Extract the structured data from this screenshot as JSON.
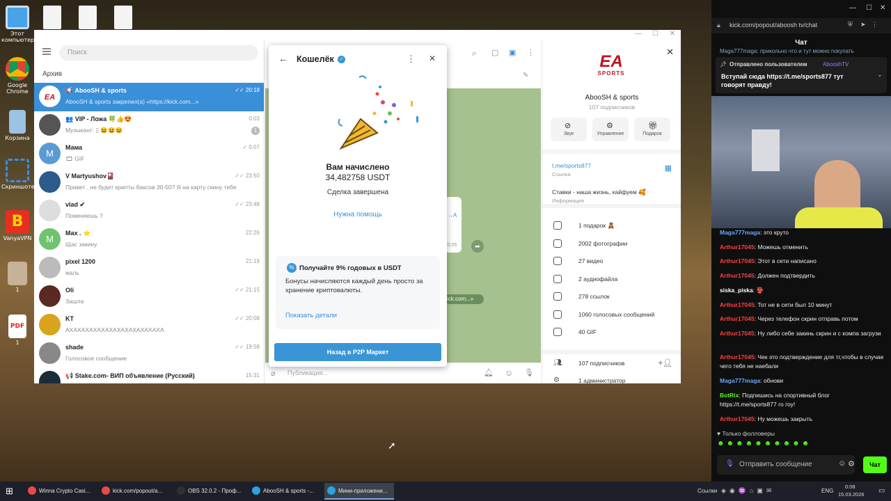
{
  "desktop": {
    "icons": [
      {
        "label": "Этот компьютер"
      },
      {
        "label": "Google Chrome"
      },
      {
        "label": "Корзина"
      },
      {
        "label": "Скриншотер"
      },
      {
        "label": "VanyaVPN"
      },
      {
        "label": "1"
      },
      {
        "label": "1"
      }
    ]
  },
  "telegram": {
    "search_placeholder": "Поиск",
    "archive_label": "Архив",
    "chats": [
      {
        "name": "📢 AbooSH & sports",
        "preview": "AbooSH & sports закрепил(а) «https://kick.com...»",
        "time": "✓✓ 20:18",
        "color": "#ffffff",
        "active": true
      },
      {
        "name": "👥 VIP - Ложа 🍀👍😍",
        "preview": "Музыкант: ▯ 😆😆😆",
        "time": "0:03",
        "badge": "1",
        "color": "#555555"
      },
      {
        "name": "Мама",
        "preview": "🎞 GIF",
        "time": "✓ 0:07",
        "color": "#5b9bd5",
        "initial": "M"
      },
      {
        "name": "V Martyushov🎴",
        "preview": "Привет , не будет крипты баксов 30-50? Я на карту скину тебе",
        "time": "✓✓ 23:50",
        "color": "#2e5a8c"
      },
      {
        "name": "vlad ✔",
        "preview": "Поменяешь ?",
        "time": "✓✓ 23:48",
        "color": "#dddddd"
      },
      {
        "name": "Max . ⭐",
        "preview": "Щас закину",
        "time": "22:26",
        "color": "#6fc36f",
        "initial": "M"
      },
      {
        "name": "pixel 1200",
        "preview": "жаль",
        "time": "21:19",
        "color": "#bbbbbb"
      },
      {
        "name": "Oli",
        "preview": "Зашла",
        "time": "✓✓ 21:15",
        "color": "#5a2a22"
      },
      {
        "name": "KT",
        "preview": "АХАХАХАХАХАХАХАХАХАХАХАХА",
        "time": "✓✓ 20:08",
        "color": "#d9a31c"
      },
      {
        "name": "shade",
        "preview": "Голосовое сообщение",
        "time": "✓✓ 19:58",
        "color": "#888888"
      },
      {
        "name": "📢 Stake.com- ВИП объявление (Русский)",
        "preview": "",
        "time": "15:31",
        "color": "#1a2c38"
      }
    ],
    "chat_input_placeholder": "Публикация...",
    "pinned_link": "ick.com...»",
    "msg_time": "20:05"
  },
  "wallet": {
    "title": "Кошелёк",
    "credited_label": "Вам начислено",
    "amount": "34,482758 USDT",
    "status": "Сделка завершена",
    "help_link": "Нужна помощь",
    "promo_title": "Получайте 9% годовых в USDT",
    "promo_text": "Бонусы начисляются каждый день просто за хранение криптовалюты.",
    "promo_link": "Показать детали",
    "back_button": "Назад в P2P Маркет"
  },
  "channel_info": {
    "name": "AbooSH & sports",
    "subscribers": "107 подписчиков",
    "actions": [
      "Звук",
      "Управление",
      "Подарок"
    ],
    "link": "t.me/sports877",
    "link_label": "Ссылка",
    "about": "Ставки - наша жизнь, кайфуем 🥰",
    "about_label": "Информация",
    "stats": [
      "1 подарок 🧸",
      "2002 фотографии",
      "27 видео",
      "2 аудиофайла",
      "278 ссылок",
      "1060 голосовых сообщений",
      "40 GIF"
    ],
    "members": "107 подписчиков",
    "admins": "1 администратор"
  },
  "kick": {
    "url": "kick.com/popout/aboosh tv/chat",
    "header": "Чат",
    "pinned_by": "Отправлено пользователем",
    "pinned_user": "AbooshTV",
    "pinned_text": "Вступай сюда https://t.me/sports877 тут говорят правду!",
    "top_line": "Maga777maga: прикольно что и тут можно покупать",
    "messages": [
      {
        "user": "Maga777maga",
        "text": "это круто",
        "color": "#6aa8ff"
      },
      {
        "user": "Arthur17045",
        "text": "Можешь отменить",
        "color": "#ff4040"
      },
      {
        "user": "Arthur17045",
        "text": "Этот в сети написано",
        "color": "#ff4040"
      },
      {
        "user": "Arthur17045",
        "text": "Должен подтвердить",
        "color": "#ff4040"
      },
      {
        "user": "siska_piska",
        "text": "👺",
        "color": "#ffffff"
      },
      {
        "user": "Arthur17045",
        "text": "Тот не в сети был 10 минут",
        "color": "#ff4040"
      },
      {
        "user": "Arthur17045",
        "text": "Через телефон скрин отправь потом",
        "color": "#ff4040"
      },
      {
        "user": "Arthur17045",
        "text": "Ну либо себе закинь скрин и с компа загрузи",
        "color": "#ff4040"
      },
      {
        "user": "Arthur17045",
        "text": "Чек это подтверждение для тг,чтобы в случае чего тебя не наебали",
        "color": "#ff4040"
      },
      {
        "user": "Maga777maga",
        "text": "обнови",
        "color": "#6aa8ff"
      },
      {
        "user": "BotRix",
        "text": "Подпишись на спортивный блог https://t.me/sports877 го гоу!",
        "color": "#53fc18"
      },
      {
        "user": "Arthur17045",
        "text": "Ну можешь закрыть",
        "color": "#ff4040"
      }
    ],
    "followers_only": "Только фолловеры",
    "send_placeholder": "Отправить сообщение",
    "send_button": "Чат"
  },
  "taskbar": {
    "items": [
      "Winna Crypto Casi...",
      "kick.com/popout/a...",
      "OBS 32.0.2 - Проф...",
      "AbooSH & sports -...",
      "Мини-приложени..."
    ],
    "tray_label": "Ссылки",
    "lang": "ENG",
    "time": "0:08",
    "date": "15.03.2026"
  }
}
